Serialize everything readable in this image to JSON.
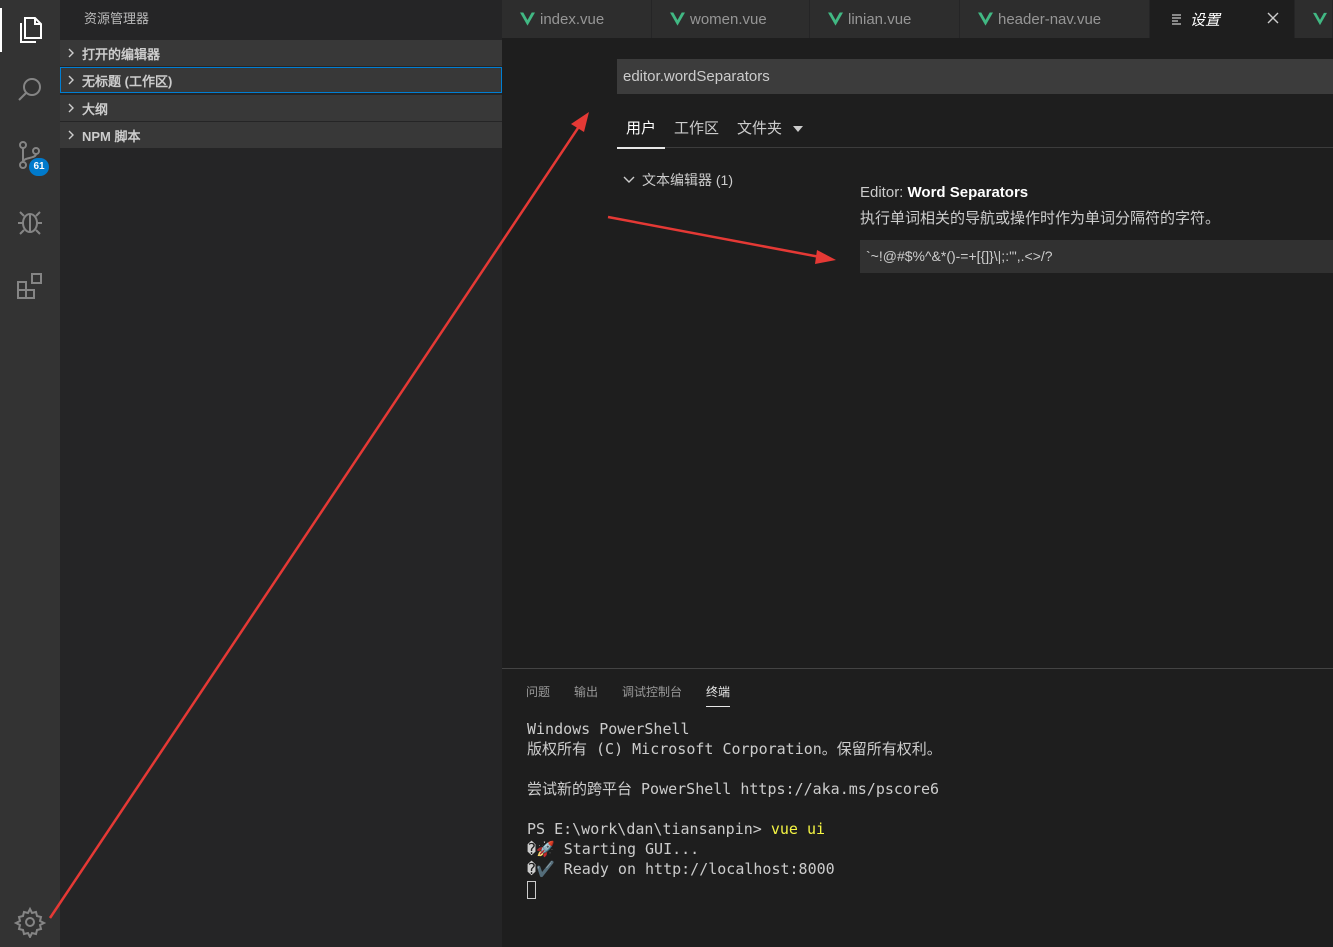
{
  "activity_bar": {
    "scm_badge": "61",
    "icons": [
      "explorer-icon",
      "search-icon",
      "source-control-icon",
      "debug-icon",
      "extensions-icon",
      "gear-icon"
    ]
  },
  "sidebar": {
    "title": "资源管理器",
    "sections": [
      {
        "label": "打开的编辑器"
      },
      {
        "label": "无标题 (工作区)"
      },
      {
        "label": "大纲"
      },
      {
        "label": "NPM 脚本"
      }
    ]
  },
  "tabs": [
    {
      "label": "index.vue"
    },
    {
      "label": "women.vue"
    },
    {
      "label": "linian.vue"
    },
    {
      "label": "header-nav.vue"
    },
    {
      "label": "设置"
    }
  ],
  "settings": {
    "search_value": "editor.wordSeparators",
    "scopes": [
      "用户",
      "工作区",
      "文件夹"
    ],
    "toc_item": "文本编辑器 (1)",
    "setting_category": "Editor:",
    "setting_key": "Word Separators",
    "setting_description": "执行单词相关的导航或操作时作为单词分隔符的字符。",
    "setting_value": "`~!@#$%^&*()-=+[{]}\\|;:'\",.<>/?"
  },
  "panel": {
    "tabs": [
      "问题",
      "输出",
      "调试控制台",
      "终端"
    ],
    "terminal": {
      "line1": "Windows PowerShell",
      "line2": "版权所有 (C) Microsoft Corporation。保留所有权利。",
      "line3": "尝试新的跨平台 PowerShell https://aka.ms/pscore6",
      "prompt": "PS E:\\work\\dan\\tiansanpin> ",
      "command": "vue ui",
      "line5": "�🚀 Starting GUI...",
      "line6": "�✔️ Ready on http://localhost:8000"
    }
  },
  "colors": {
    "accent": "#007acc",
    "annotation_arrow": "#e53935",
    "vue_green": "#41b883"
  }
}
